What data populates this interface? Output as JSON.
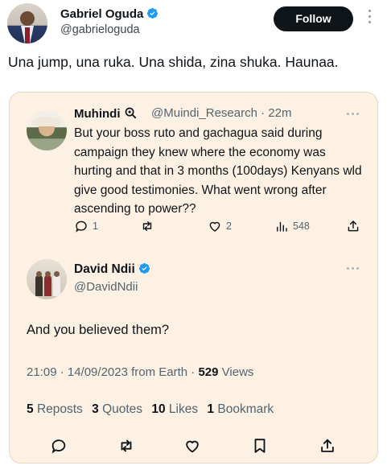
{
  "post": {
    "author": {
      "name": "Gabriel Oguda",
      "handle": "@gabrieloguda",
      "verified": true
    },
    "follow_label": "Follow",
    "text": "Una jump, una ruka. Una shida, zina shuka. Haunaa."
  },
  "quoted": {
    "parent": {
      "author": "Muhindi",
      "badge_icon": "magnifier-icon",
      "handle_time": "@Muindi_Research · 22m",
      "text": "But your boss ruto and gachagua said during campaign they knew where the economy was hurting and that in 3 months (100days) Kenyans wld give good testimonies. What went wrong after ascending to power??",
      "actions": {
        "replies": "1",
        "likes": "2",
        "views": "548"
      }
    },
    "reply": {
      "author": "David Ndii",
      "handle": "@DavidNdii",
      "verified": true,
      "text": "And you believed them?",
      "time": "21:09 · 14/09/2023 from Earth ·",
      "views_count": "529",
      "views_label": "Views",
      "stats": {
        "reposts_count": "5",
        "reposts_label": "Reposts",
        "quotes_count": "3",
        "quotes_label": "Quotes",
        "likes_count": "10",
        "likes_label": "Likes",
        "bookmarks_count": "1",
        "bookmarks_label": "Bookmark"
      }
    }
  },
  "colors": {
    "card_bg": "#fdf1e3",
    "verified_blue": "#1d9bf0",
    "text_primary": "#0f1419",
    "text_secondary": "#536471"
  }
}
